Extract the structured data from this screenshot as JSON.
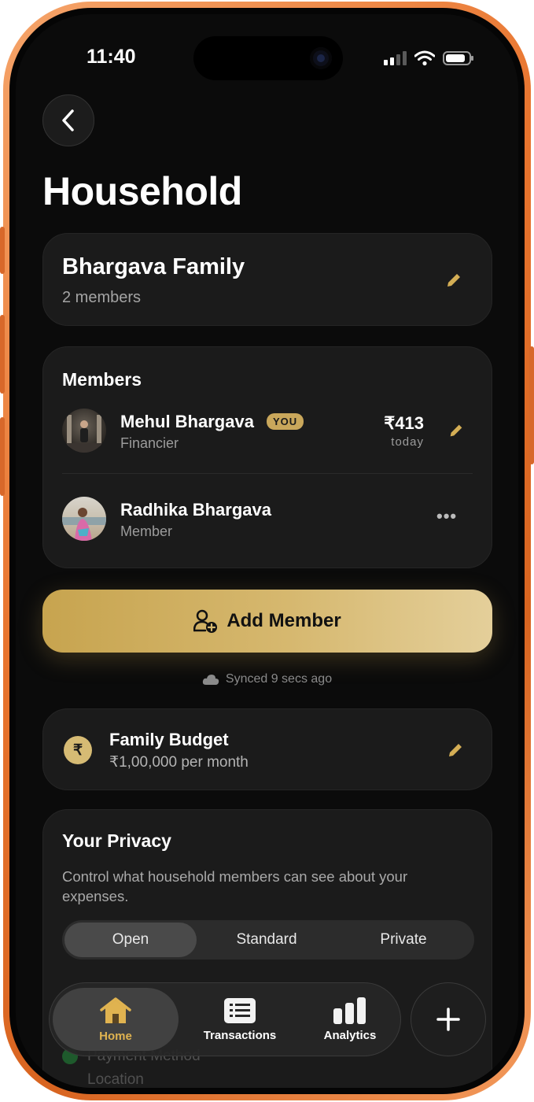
{
  "status": {
    "time": "11:40"
  },
  "page": {
    "title": "Household"
  },
  "family": {
    "name": "Bhargava Family",
    "members_count": "2 members"
  },
  "members": {
    "title": "Members",
    "list": [
      {
        "name": "Mehul Bhargava",
        "badge": "YOU",
        "role": "Financier",
        "amount": "₹413",
        "amount_sub": "today"
      },
      {
        "name": "Radhika Bhargava",
        "role": "Member",
        "more": "•••"
      }
    ]
  },
  "add_member": {
    "label": "Add Member"
  },
  "sync": {
    "text": "Synced 9 secs ago"
  },
  "budget": {
    "title": "Family Budget",
    "amount": "₹1,00,000 per month",
    "symbol": "₹"
  },
  "privacy": {
    "title": "Your Privacy",
    "description": "Control what household members can see about your expenses.",
    "options": [
      "Open",
      "Standard",
      "Private"
    ],
    "selected": "Open",
    "faded_rows": [
      "Payment Method",
      "Location"
    ]
  },
  "tabbar": {
    "items": [
      {
        "label": "Home",
        "active": true
      },
      {
        "label": "Transactions"
      },
      {
        "label": "Analytics"
      }
    ]
  },
  "colors": {
    "accent_gold": "#c9a75b",
    "background": "#0b0b0b",
    "card": "#1b1b1b",
    "frame_orange": "#e8742e"
  }
}
